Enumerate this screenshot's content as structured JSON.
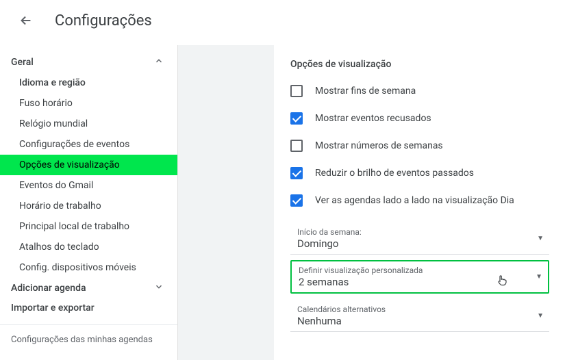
{
  "header": {
    "title": "Configurações"
  },
  "sidebar": {
    "general": {
      "label": "Geral",
      "items": [
        "Idioma e região",
        "Fuso horário",
        "Relógio mundial",
        "Configurações de eventos",
        "Opções de visualização",
        "Eventos do Gmail",
        "Horário de trabalho",
        "Principal local de trabalho",
        "Atalhos do teclado",
        "Config. dispositivos móveis"
      ]
    },
    "add_calendar": "Adicionar agenda",
    "import_export": "Importar e exportar",
    "my_calendars": "Configurações das minhas agendas"
  },
  "content": {
    "title": "Opções de visualização",
    "checks": [
      {
        "label": "Mostrar fins de semana",
        "checked": false
      },
      {
        "label": "Mostrar eventos recusados",
        "checked": true
      },
      {
        "label": "Mostrar números de semanas",
        "checked": false
      },
      {
        "label": "Reduzir o brilho de eventos passados",
        "checked": true
      },
      {
        "label": "Ver as agendas lado a lado na visualização Dia",
        "checked": true
      }
    ],
    "dropdowns": [
      {
        "label": "Início da semana:",
        "value": "Domingo"
      },
      {
        "label": "Definir visualização personalizada",
        "value": "2 semanas"
      },
      {
        "label": "Calendários alternativos",
        "value": "Nenhuma"
      }
    ]
  }
}
